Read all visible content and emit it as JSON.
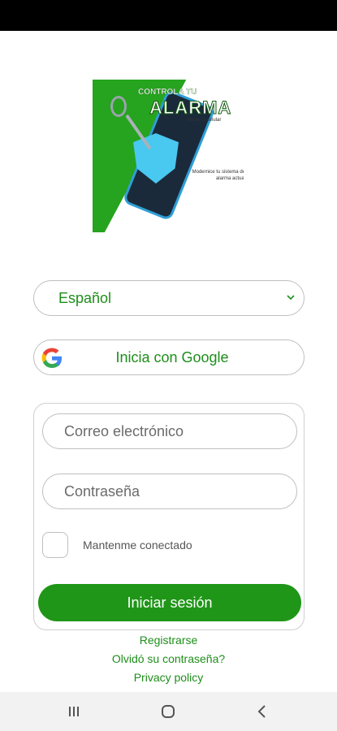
{
  "promo": {
    "line1": "CONTROLA TU",
    "line2": "ALARMA",
    "line3": "desde tu celular",
    "line4": "Modernice tu sistema de alarma actual"
  },
  "language": {
    "selected": "Español"
  },
  "google": {
    "label": "Inicia con Google"
  },
  "form": {
    "email_placeholder": "Correo electrónico",
    "password_placeholder": "Contraseña",
    "remember_label": "Mantenme conectado",
    "login_label": "Iniciar sesión"
  },
  "links": {
    "register": "Registrarse",
    "forgot": "Olvidó su contraseña?",
    "privacy": "Privacy policy"
  },
  "colors": {
    "accent": "#1f9617",
    "text_green": "#1e8e1a"
  }
}
